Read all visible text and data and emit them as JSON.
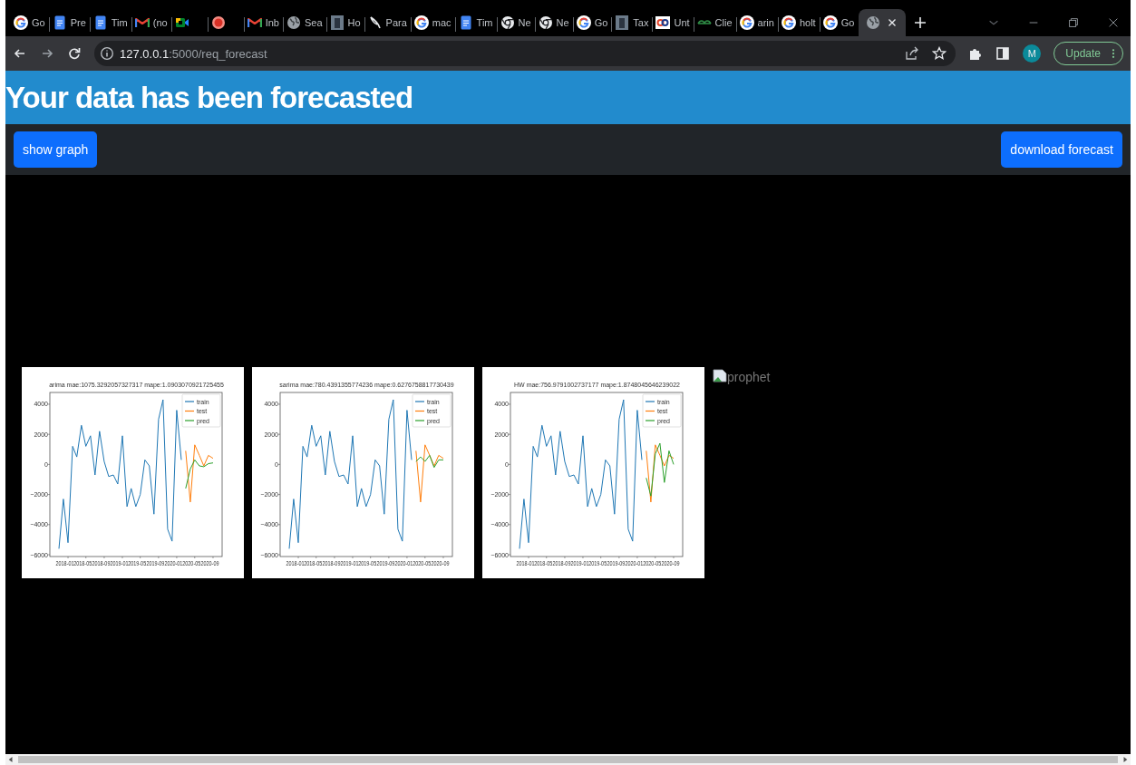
{
  "browser": {
    "tabs": [
      {
        "kind": "google",
        "title": "Go",
        "selected": false
      },
      {
        "kind": "docs",
        "title": "Pre",
        "selected": false
      },
      {
        "kind": "docs",
        "title": "Tim",
        "selected": false
      },
      {
        "kind": "gmail",
        "title": "(no",
        "selected": false
      },
      {
        "kind": "meet",
        "selected": false
      },
      {
        "kind": "record",
        "selected": false
      },
      {
        "kind": "gmail",
        "title": "Inb",
        "selected": false
      },
      {
        "kind": "globe",
        "title": "Sea",
        "selected": false
      },
      {
        "kind": "photo",
        "title": "Ho",
        "selected": false
      },
      {
        "kind": "feather",
        "title": "Para",
        "selected": false
      },
      {
        "kind": "google",
        "title": "mac",
        "selected": false
      },
      {
        "kind": "docs",
        "title": "Tim",
        "selected": false
      },
      {
        "kind": "chrome",
        "title": "Ne",
        "selected": false
      },
      {
        "kind": "chrome",
        "title": "Ne",
        "selected": false
      },
      {
        "kind": "google",
        "title": "Go",
        "selected": false
      },
      {
        "kind": "photo",
        "title": "Tax",
        "selected": false
      },
      {
        "kind": "loop",
        "title": "Unt",
        "selected": false
      },
      {
        "kind": "gfg",
        "title": "Clie",
        "selected": false
      },
      {
        "kind": "google",
        "title": "arin",
        "selected": false
      },
      {
        "kind": "google",
        "title": "holt",
        "selected": false
      },
      {
        "kind": "google",
        "title": "Go",
        "selected": false
      },
      {
        "kind": "globe",
        "selected": true
      }
    ],
    "address": {
      "host": "127.0.0.1",
      "path": ":5000/req_forecast"
    },
    "profile": "M",
    "update_button": "Update"
  },
  "page": {
    "heading": "Your data has been forecasted",
    "buttons": [
      "show graph",
      "download forecast"
    ],
    "charts": [
      {
        "chart_data": {
          "type": "line",
          "title": "arima mae:1075.3292057327317 mape:1.0903070921725455",
          "x": [
            "2017-11",
            "2017-12",
            "2018-01",
            "2018-02",
            "2018-03",
            "2018-04",
            "2018-05",
            "2018-06",
            "2018-07",
            "2018-08",
            "2018-09",
            "2018-10",
            "2018-11",
            "2018-12",
            "2019-01",
            "2019-02",
            "2019-03",
            "2019-04",
            "2019-05",
            "2019-06",
            "2019-07",
            "2019-08",
            "2019-09",
            "2019-10",
            "2019-11",
            "2019-12",
            "2020-01",
            "2020-02",
            "2020-03",
            "2020-04",
            "2020-05",
            "2020-06",
            "2020-07",
            "2020-08",
            "2020-09"
          ],
          "series": [
            {
              "name": "train",
              "color": "#1f77b4",
              "values": [
                -5600,
                -2300,
                -5200,
                1200,
                500,
                2600,
                1200,
                1900,
                -700,
                2200,
                200,
                -800,
                -700,
                -1300,
                1900,
                -2800,
                -1600,
                -2800,
                -2000,
                300,
                -100,
                -3300,
                3000,
                4300,
                -4300,
                -5100,
                3600,
                300,
                null,
                null,
                null,
                null,
                null,
                null,
                null
              ]
            },
            {
              "name": "test",
              "color": "#ff7f0e",
              "values": [
                null,
                null,
                null,
                null,
                null,
                null,
                null,
                null,
                null,
                null,
                null,
                null,
                null,
                null,
                null,
                null,
                null,
                null,
                null,
                null,
                null,
                null,
                null,
                null,
                null,
                null,
                null,
                null,
                900,
                -2500,
                1300,
                600,
                -100,
                600,
                400
              ]
            },
            {
              "name": "pred",
              "color": "#2ca02c",
              "values": [
                null,
                null,
                null,
                null,
                null,
                null,
                null,
                null,
                null,
                null,
                null,
                null,
                null,
                null,
                null,
                null,
                null,
                null,
                null,
                null,
                null,
                null,
                null,
                null,
                null,
                null,
                null,
                null,
                -1600,
                -300,
                300,
                -100,
                -150,
                50,
                100
              ]
            }
          ],
          "xlim": [
            "2017-09",
            "2020-11"
          ],
          "ylim": [
            -6120,
            4780
          ],
          "xticks": [
            "2018-01",
            "2018-05",
            "2018-09",
            "2019-01",
            "2019-05",
            "2019-09",
            "2020-01",
            "2020-05",
            "2020-09"
          ],
          "yticks": [
            -6000,
            -4000,
            -2000,
            0,
            2000,
            4000
          ],
          "legend": true
        }
      },
      {
        "chart_data": {
          "type": "line",
          "title": "sarima mae:780.4391355774236 mape:0.6276758817730439",
          "x": [
            "2017-11",
            "2017-12",
            "2018-01",
            "2018-02",
            "2018-03",
            "2018-04",
            "2018-05",
            "2018-06",
            "2018-07",
            "2018-08",
            "2018-09",
            "2018-10",
            "2018-11",
            "2018-12",
            "2019-01",
            "2019-02",
            "2019-03",
            "2019-04",
            "2019-05",
            "2019-06",
            "2019-07",
            "2019-08",
            "2019-09",
            "2019-10",
            "2019-11",
            "2019-12",
            "2020-01",
            "2020-02",
            "2020-03",
            "2020-04",
            "2020-05",
            "2020-06",
            "2020-07",
            "2020-08",
            "2020-09"
          ],
          "series": [
            {
              "name": "train",
              "color": "#1f77b4",
              "values": [
                -5600,
                -2300,
                -5200,
                1200,
                500,
                2600,
                1200,
                1900,
                -700,
                2200,
                200,
                -800,
                -700,
                -1300,
                1900,
                -2800,
                -1600,
                -2800,
                -2000,
                300,
                -100,
                -3300,
                3000,
                4300,
                -4300,
                -5100,
                3600,
                300,
                null,
                null,
                null,
                null,
                null,
                null,
                null
              ]
            },
            {
              "name": "test",
              "color": "#ff7f0e",
              "values": [
                null,
                null,
                null,
                null,
                null,
                null,
                null,
                null,
                null,
                null,
                null,
                null,
                null,
                null,
                null,
                null,
                null,
                null,
                null,
                null,
                null,
                null,
                null,
                null,
                null,
                null,
                null,
                null,
                900,
                -2500,
                1300,
                600,
                -100,
                600,
                400
              ]
            },
            {
              "name": "pred",
              "color": "#2ca02c",
              "values": [
                null,
                null,
                null,
                null,
                null,
                null,
                null,
                null,
                null,
                null,
                null,
                null,
                null,
                null,
                null,
                null,
                null,
                null,
                null,
                null,
                null,
                null,
                null,
                null,
                null,
                null,
                null,
                null,
                200,
                500,
                200,
                600,
                -200,
                300,
                300
              ]
            }
          ],
          "xlim": [
            "2017-09",
            "2020-11"
          ],
          "ylim": [
            -6120,
            4780
          ],
          "xticks": [
            "2018-01",
            "2018-05",
            "2018-09",
            "2019-01",
            "2019-05",
            "2019-09",
            "2020-01",
            "2020-05",
            "2020-09"
          ],
          "yticks": [
            -6000,
            -4000,
            -2000,
            0,
            2000,
            4000
          ],
          "legend": true
        }
      },
      {
        "chart_data": {
          "type": "line",
          "title": "HW mae:756.9791002737177 mape:1.8748045646239022",
          "x": [
            "2017-11",
            "2017-12",
            "2018-01",
            "2018-02",
            "2018-03",
            "2018-04",
            "2018-05",
            "2018-06",
            "2018-07",
            "2018-08",
            "2018-09",
            "2018-10",
            "2018-11",
            "2018-12",
            "2019-01",
            "2019-02",
            "2019-03",
            "2019-04",
            "2019-05",
            "2019-06",
            "2019-07",
            "2019-08",
            "2019-09",
            "2019-10",
            "2019-11",
            "2019-12",
            "2020-01",
            "2020-02",
            "2020-03",
            "2020-04",
            "2020-05",
            "2020-06",
            "2020-07",
            "2020-08",
            "2020-09"
          ],
          "series": [
            {
              "name": "train",
              "color": "#1f77b4",
              "values": [
                -5600,
                -2300,
                -5200,
                1200,
                500,
                2600,
                1200,
                1900,
                -700,
                2200,
                200,
                -800,
                -700,
                -1300,
                1900,
                -2800,
                -1600,
                -2800,
                -2000,
                300,
                -100,
                -3300,
                3000,
                4300,
                -4300,
                -5100,
                3600,
                300,
                null,
                null,
                null,
                null,
                null,
                null,
                null
              ]
            },
            {
              "name": "test",
              "color": "#ff7f0e",
              "values": [
                null,
                null,
                null,
                null,
                null,
                null,
                null,
                null,
                null,
                null,
                null,
                null,
                null,
                null,
                null,
                null,
                null,
                null,
                null,
                null,
                null,
                null,
                null,
                null,
                null,
                null,
                null,
                null,
                900,
                -2500,
                1300,
                600,
                -100,
                600,
                400
              ]
            },
            {
              "name": "pred",
              "color": "#2ca02c",
              "values": [
                null,
                null,
                null,
                null,
                null,
                null,
                null,
                null,
                null,
                null,
                null,
                null,
                null,
                null,
                null,
                null,
                null,
                null,
                null,
                null,
                null,
                null,
                null,
                null,
                null,
                null,
                null,
                null,
                -900,
                -2100,
                700,
                1400,
                -1200,
                900,
                0
              ]
            }
          ],
          "xlim": [
            "2017-09",
            "2020-11"
          ],
          "ylim": [
            -6120,
            4780
          ],
          "xticks": [
            "2018-01",
            "2018-05",
            "2018-09",
            "2019-01",
            "2019-05",
            "2019-09",
            "2020-01",
            "2020-05",
            "2020-09"
          ],
          "yticks": [
            -6000,
            -4000,
            -2000,
            0,
            2000,
            4000
          ],
          "legend": true
        }
      }
    ],
    "broken_image": {
      "alt": "prophet"
    }
  }
}
